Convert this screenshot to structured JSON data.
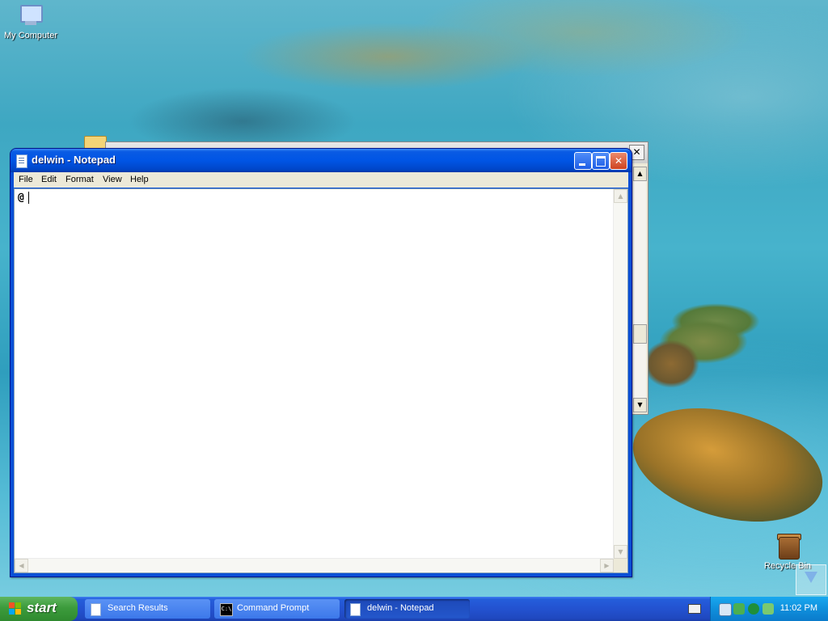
{
  "desktop": {
    "icons": [
      {
        "label": "My Computer",
        "icon": "computer-icon"
      },
      {
        "label": "Recycle Bin",
        "icon": "recycle-bin-icon"
      }
    ]
  },
  "notepad": {
    "title": "delwin - Notepad",
    "menu": [
      "File",
      "Edit",
      "Format",
      "View",
      "Help"
    ],
    "content": "@",
    "buttons": {
      "minimize": "minimize-icon",
      "maximize": "maximize-icon",
      "close": "close-icon"
    }
  },
  "taskbar": {
    "start_label": "start",
    "tasks": [
      {
        "label": "Search Results",
        "icon": "search-results-icon",
        "active": false
      },
      {
        "label": "Command Prompt",
        "icon": "command-prompt-icon",
        "active": false
      },
      {
        "label": "delwin - Notepad",
        "icon": "notepad-icon",
        "active": true
      }
    ],
    "tray": {
      "icons": [
        "network-icon",
        "security-icon",
        "update-icon",
        "volume-icon"
      ],
      "clock": "11:02 PM"
    }
  },
  "colors": {
    "title_bar": "#0055e5",
    "start_button": "#3c9b3c",
    "taskbar": "#2352d0",
    "tray": "#0f8fdc"
  }
}
